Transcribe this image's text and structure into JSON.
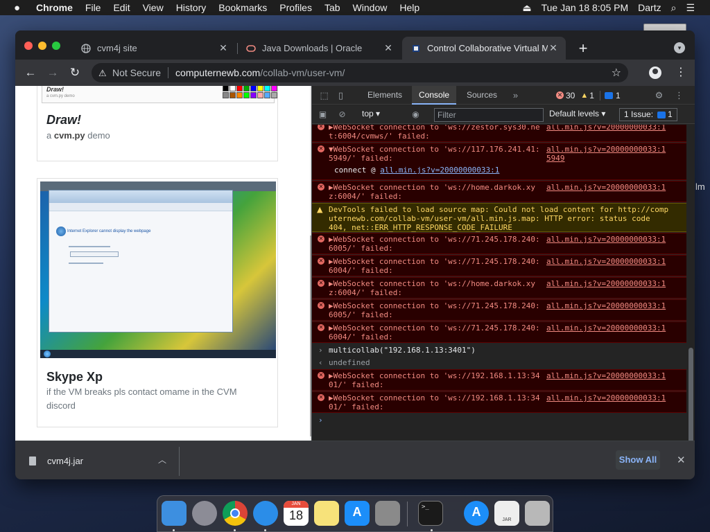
{
  "menubar": {
    "app": "Chrome",
    "items": [
      "File",
      "Edit",
      "View",
      "History",
      "Bookmarks",
      "Profiles",
      "Tab",
      "Window",
      "Help"
    ],
    "datetime": "Tue Jan 18  8:05 PM",
    "user": "Dartz"
  },
  "desktop": {
    "edge_label": "lm"
  },
  "tabs": [
    {
      "title": "cvm4j site",
      "favicon": "globe-icon"
    },
    {
      "title": "Java Downloads | Oracle",
      "favicon": "oracle-icon"
    },
    {
      "title": "Control Collaborative Virtual M",
      "favicon": "cvm-icon"
    }
  ],
  "toolbar": {
    "security": "Not Secure",
    "url_host": "computernewb.com",
    "url_path": "/collab-vm/user-vm/"
  },
  "page": {
    "card1": {
      "thumb_title": "Draw!",
      "thumb_sub": "a cvm.py demo",
      "title": "Draw!",
      "sub_prefix": "a ",
      "sub_bold": "cvm.py",
      "sub_suffix": " demo"
    },
    "card2": {
      "title": "Skype Xp",
      "sub": "if the VM breaks pls contact omame in the CVM discord",
      "ie_msg": "Internet Explorer cannot display the webpage"
    },
    "palette": [
      "#000000",
      "#ffffff",
      "#ff0000",
      "#00aa00",
      "#0000ff",
      "#ffff00",
      "#00ffff",
      "#ff00ff",
      "#888888",
      "#aa5500",
      "#ff8800",
      "#00ff00",
      "#8800ff",
      "#ffaaaa",
      "#55aaff",
      "#aaaaaa"
    ]
  },
  "devtools": {
    "tabs": [
      "Elements",
      "Console",
      "Sources"
    ],
    "active_tab": "Console",
    "errors": "30",
    "warnings": "1",
    "messages": "1",
    "context": "top",
    "filter_placeholder": "Filter",
    "levels": "Default levels",
    "issues": "1 Issue:",
    "issues_count": "1",
    "entries": [
      {
        "type": "error",
        "l1": "▶WebSocket connection to 'ws://zestor.sys30.ne",
        "l2": "t:6004/cvmws/' failed:",
        "src1": "all.min.js?v=20000000033:1"
      },
      {
        "type": "error",
        "l1": "▼WebSocket connection to 'ws://117.176.241.41:",
        "l2": "5949/' failed:",
        "src1": "all.min.js?v=20000000033:1",
        "src2": "5949",
        "sub_prefix": "connect @ ",
        "sub_link": "all.min.js?v=20000000033:1"
      },
      {
        "type": "error",
        "l1": "▶WebSocket connection to 'ws://home.darkok.xy",
        "l2": "z:6004/' failed:",
        "src1": "all.min.js?v=20000000033:1"
      },
      {
        "type": "warning",
        "l1": "DevTools failed to load source map: Could not load content for http://comp",
        "l2": "uternewb.com/collab-vm/user-vm/all.min.js.map: HTTP error: status code",
        "l3": "404, net::ERR_HTTP_RESPONSE_CODE_FAILURE"
      },
      {
        "type": "error",
        "l1": "▶WebSocket connection to 'ws://71.245.178.240:",
        "l2": "6005/' failed:",
        "src1": "all.min.js?v=20000000033:1"
      },
      {
        "type": "error",
        "l1": "▶WebSocket connection to 'ws://71.245.178.240:",
        "l2": "6004/' failed:",
        "src1": "all.min.js?v=20000000033:1"
      },
      {
        "type": "error",
        "l1": "▶WebSocket connection to 'ws://home.darkok.xy",
        "l2": "z:6004/' failed:",
        "src1": "all.min.js?v=20000000033:1"
      },
      {
        "type": "error",
        "l1": "▶WebSocket connection to 'ws://71.245.178.240:",
        "l2": "6005/' failed:",
        "src1": "all.min.js?v=20000000033:1"
      },
      {
        "type": "error",
        "l1": "▶WebSocket connection to 'ws://71.245.178.240:",
        "l2": "6004/' failed:",
        "src1": "all.min.js?v=20000000033:1"
      }
    ],
    "command": "multicollab(\"192.168.1.13:3401\")",
    "result": "undefined",
    "entries_after": [
      {
        "type": "error",
        "l1": "▶WebSocket connection to 'ws://192.168.1.13:34",
        "l2": "01/' failed:",
        "src1": "all.min.js?v=20000000033:1"
      },
      {
        "type": "error",
        "l1": "▶WebSocket connection to 'ws://192.168.1.13:34",
        "l2": "01/' failed:",
        "src1": "all.min.js?v=20000000033:1"
      }
    ],
    "prompt": "›"
  },
  "downloads": {
    "file": "cvm4j.jar",
    "show_all": "Show All"
  },
  "dock": [
    {
      "name": "finder-icon",
      "color": "#3d8fe0"
    },
    {
      "name": "launchpad-icon",
      "color": "#8c8c96"
    },
    {
      "name": "chrome-icon",
      "color": "#e8e8e8"
    },
    {
      "name": "safari-icon",
      "color": "#2b8de8"
    },
    {
      "name": "calendar-icon",
      "color": "#ffffff"
    },
    {
      "name": "notes-icon",
      "color": "#f7e27a"
    },
    {
      "name": "app-store-icon",
      "color": "#1c8ef9"
    },
    {
      "name": "system-preferences-icon",
      "color": "#8a8a8a"
    },
    {
      "name": "terminal-icon",
      "color": "#1a1a1a"
    },
    {
      "name": "app-store-downloads-icon",
      "color": "#1c8ef9"
    },
    {
      "name": "jar-file-icon",
      "color": "#eeeeee"
    },
    {
      "name": "trash-icon",
      "color": "#b8b8b8"
    }
  ],
  "dock_calendar": {
    "month": "JAN",
    "day": "18"
  },
  "dock_jar_label": "JAR"
}
